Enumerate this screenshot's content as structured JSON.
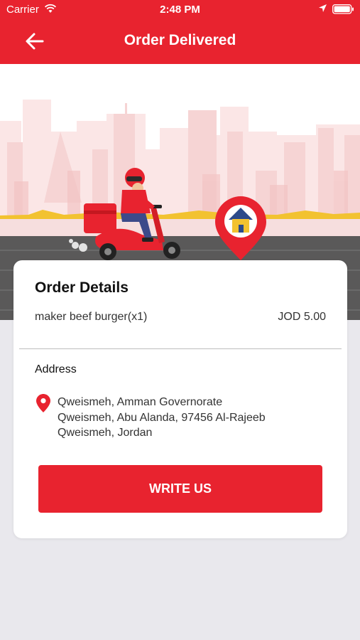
{
  "status_bar": {
    "carrier": "Carrier",
    "time": "2:48 PM",
    "wifi_icon": "wifi-icon",
    "location_icon": "location-arrow-icon",
    "battery_icon": "battery-icon"
  },
  "header": {
    "title": "Order Delivered",
    "back_icon": "back-arrow-icon"
  },
  "hero": {
    "illustration": "delivery-scooter-illustration",
    "destination_icon": "home-pin-icon"
  },
  "order": {
    "title": "Order Details",
    "items": [
      {
        "name": "maker beef burger(x1)",
        "price": "JOD 5.00"
      }
    ]
  },
  "address": {
    "label": "Address",
    "icon": "location-pin-icon",
    "lines": [
      "Qweismeh, Amman Governorate",
      "Qweismeh, Abu Alanda, 97456 Al-Rajeeb",
      "Qweismeh, Jordan"
    ]
  },
  "actions": {
    "write_us": "WRITE US"
  },
  "colors": {
    "brand_red": "#e8232f",
    "background": "#e9e8ed",
    "card": "#ffffff"
  }
}
